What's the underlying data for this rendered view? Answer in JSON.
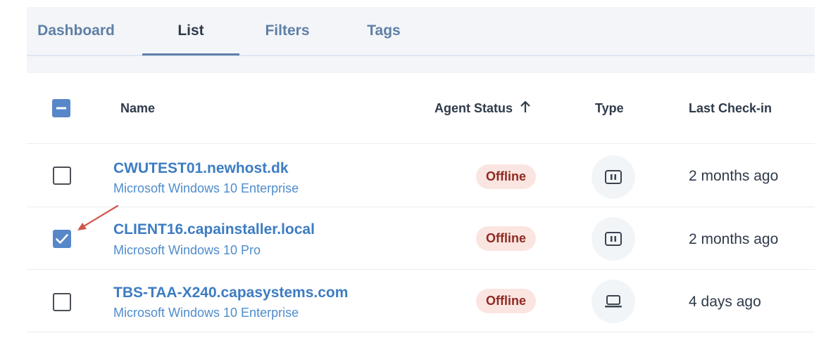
{
  "tabs": [
    {
      "label": "Dashboard",
      "active": false
    },
    {
      "label": "List",
      "active": true
    },
    {
      "label": "Filters",
      "active": false
    },
    {
      "label": "Tags",
      "active": false
    }
  ],
  "table": {
    "columns": {
      "name": "Name",
      "agent_status": "Agent Status",
      "type": "Type",
      "last_checkin": "Last Check-in"
    },
    "sort": {
      "column": "Agent Status",
      "direction": "ascending",
      "icon": "arrow-up-icon"
    },
    "select_all_state": "indeterminate",
    "rows": [
      {
        "name": "CWUTEST01.newhost.dk",
        "os": "Microsoft Windows 10 Enterprise",
        "status": "Offline",
        "type_icon": "server-icon",
        "last_checkin": "2 months ago",
        "selected": false
      },
      {
        "name": "CLIENT16.capainstaller.local",
        "os": "Microsoft Windows 10 Pro",
        "status": "Offline",
        "type_icon": "server-icon",
        "last_checkin": "2 months ago",
        "selected": true
      },
      {
        "name": "TBS-TAA-X240.capasystems.com",
        "os": "Microsoft Windows 10 Enterprise",
        "status": "Offline",
        "type_icon": "laptop-icon",
        "last_checkin": "4 days ago",
        "selected": false
      }
    ]
  },
  "colors": {
    "accent": "#5887c9",
    "link": "#3d7cc2",
    "offline_badge_bg": "#fbe5e1",
    "offline_badge_text": "#8e2b22",
    "annotation_arrow": "#d0574a"
  }
}
